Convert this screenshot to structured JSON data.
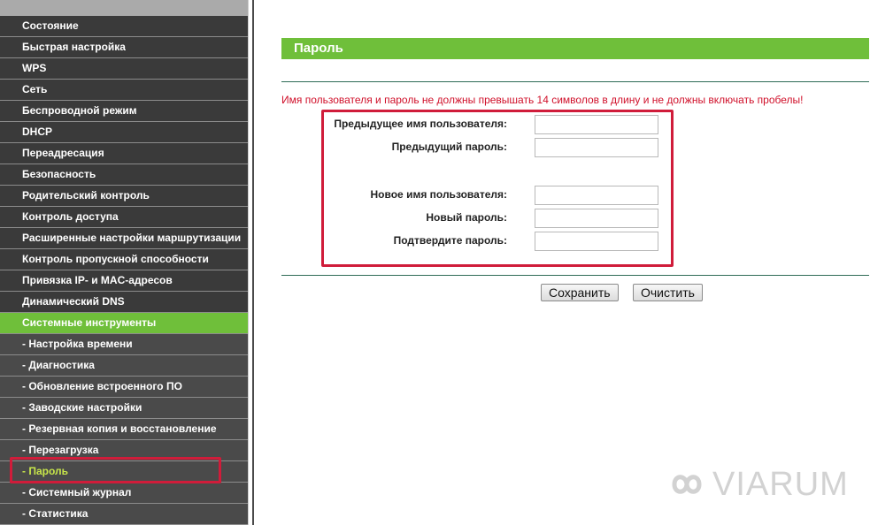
{
  "sidebar": {
    "items": [
      {
        "label": "Состояние",
        "type": "main"
      },
      {
        "label": "Быстрая настройка",
        "type": "main"
      },
      {
        "label": "WPS",
        "type": "main"
      },
      {
        "label": "Сеть",
        "type": "main"
      },
      {
        "label": "Беспроводной режим",
        "type": "main"
      },
      {
        "label": "DHCP",
        "type": "main"
      },
      {
        "label": "Переадресация",
        "type": "main"
      },
      {
        "label": "Безопасность",
        "type": "main"
      },
      {
        "label": "Родительский контроль",
        "type": "main"
      },
      {
        "label": "Контроль доступа",
        "type": "main"
      },
      {
        "label": "Расширенные настройки маршрутизации",
        "type": "main"
      },
      {
        "label": "Контроль пропускной способности",
        "type": "main"
      },
      {
        "label": "Привязка IP- и MAC-адресов",
        "type": "main"
      },
      {
        "label": "Динамический DNS",
        "type": "main"
      },
      {
        "label": "Системные инструменты",
        "type": "active-group"
      },
      {
        "label": "- Настройка времени",
        "type": "sub"
      },
      {
        "label": "- Диагностика",
        "type": "sub"
      },
      {
        "label": "- Обновление встроенного ПО",
        "type": "sub"
      },
      {
        "label": "- Заводские настройки",
        "type": "sub"
      },
      {
        "label": "- Резервная копия и восстановление",
        "type": "sub"
      },
      {
        "label": "- Перезагрузка",
        "type": "sub"
      },
      {
        "label": "- Пароль",
        "type": "current"
      },
      {
        "label": "- Системный журнал",
        "type": "sub"
      },
      {
        "label": "- Статистика",
        "type": "sub"
      }
    ]
  },
  "main": {
    "title": "Пароль",
    "warning": "Имя пользователя и пароль не должны превышать 14 символов в длину и не должны включать пробелы!",
    "fields": {
      "old_username": {
        "label": "Предыдущее имя пользователя:",
        "value": ""
      },
      "old_password": {
        "label": "Предыдущий пароль:",
        "value": ""
      },
      "new_username": {
        "label": "Новое имя пользователя:",
        "value": ""
      },
      "new_password": {
        "label": "Новый пароль:",
        "value": ""
      },
      "confirm_password": {
        "label": "Подтвердите пароль:",
        "value": ""
      }
    },
    "buttons": {
      "save": "Сохранить",
      "clear": "Очистить"
    }
  },
  "watermark": {
    "text": "VIARUM"
  },
  "colors": {
    "accent_green": "#6fbf3a",
    "sidebar_bg": "#3a3a3a",
    "highlight_red": "#d01c3a",
    "warning_red": "#d0102a",
    "current_item": "#c8e64a"
  }
}
